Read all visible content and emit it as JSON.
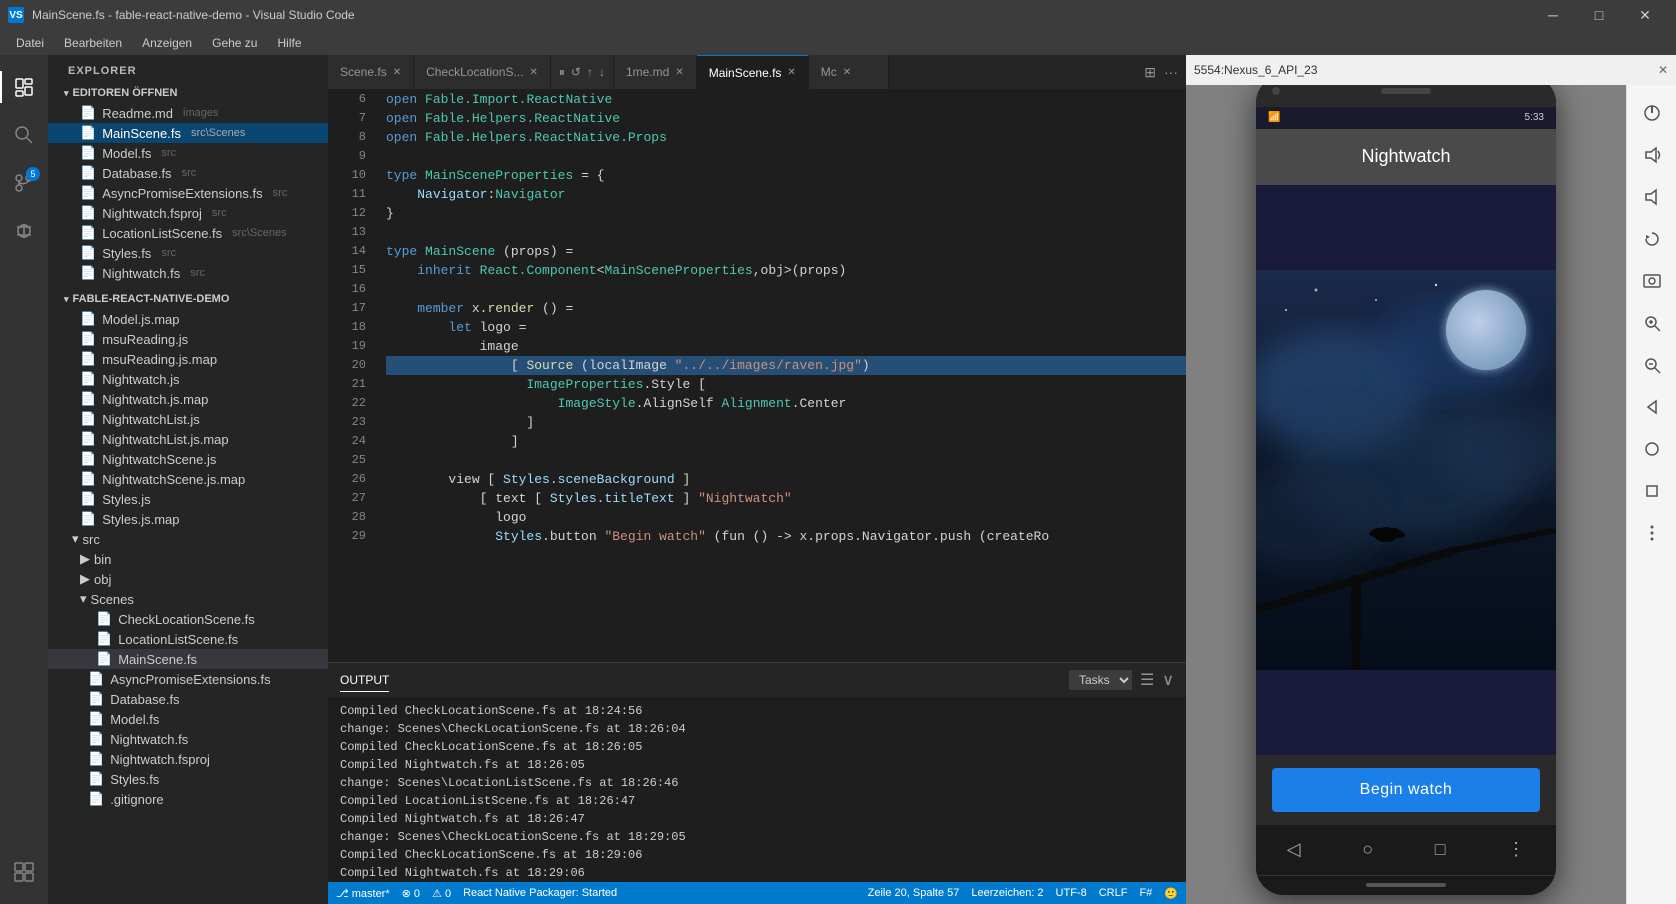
{
  "titleBar": {
    "icon": "VS",
    "title": "MainScene.fs - fable-react-native-demo - Visual Studio Code",
    "minimize": "─",
    "maximize": "□",
    "close": "✕"
  },
  "menuBar": {
    "items": [
      "Datei",
      "Bearbeiten",
      "Anzeigen",
      "Gehe zu",
      "Hilfe"
    ]
  },
  "activityBar": {
    "icons": [
      "files",
      "search",
      "git",
      "debug",
      "extensions"
    ]
  },
  "sidebar": {
    "title": "EXPLORER",
    "openEditors": {
      "label": "EDITOREN ÖFFNEN",
      "items": [
        {
          "name": "Readme.md",
          "hint": "images",
          "indent": 1
        },
        {
          "name": "MainScene.fs",
          "hint": "src\\Scenes",
          "indent": 1,
          "active": true
        },
        {
          "name": "Model.fs",
          "hint": "src",
          "indent": 1
        },
        {
          "name": "Database.fs",
          "hint": "src",
          "indent": 1
        },
        {
          "name": "AsyncPromiseExtensions.fs",
          "hint": "src",
          "indent": 1
        },
        {
          "name": "Nightwatch.fsproj",
          "hint": "src",
          "indent": 1
        },
        {
          "name": "LocationListScene.fs",
          "hint": "src\\Scenes",
          "indent": 1
        },
        {
          "name": "Styles.fs",
          "hint": "src",
          "indent": 1
        },
        {
          "name": "Nightwatch.fs",
          "hint": "src",
          "indent": 1
        }
      ]
    },
    "project": {
      "label": "FABLE-REACT-NATIVE-DEMO",
      "items": [
        {
          "name": "Model.js.map",
          "indent": 1
        },
        {
          "name": "msuReading.js",
          "indent": 1
        },
        {
          "name": "msuReading.js.map",
          "indent": 1
        },
        {
          "name": "Nightwatch.js",
          "indent": 1
        },
        {
          "name": "Nightwatch.js.map",
          "indent": 1
        },
        {
          "name": "NightwatchList.js",
          "indent": 1
        },
        {
          "name": "NightwatchList.js.map",
          "indent": 1
        },
        {
          "name": "NightwatchScene.js",
          "indent": 1
        },
        {
          "name": "NightwatchScene.js.map",
          "indent": 1
        },
        {
          "name": "Styles.js",
          "indent": 1
        },
        {
          "name": "Styles.js.map",
          "indent": 1
        },
        {
          "name": "src",
          "indent": 0,
          "isFolder": true
        },
        {
          "name": "bin",
          "indent": 1,
          "isFolder": true
        },
        {
          "name": "obj",
          "indent": 1,
          "isFolder": true
        },
        {
          "name": "Scenes",
          "indent": 1,
          "isFolder": true
        },
        {
          "name": "CheckLocationScene.fs",
          "indent": 2
        },
        {
          "name": "LocationListScene.fs",
          "indent": 2
        },
        {
          "name": "MainScene.fs",
          "indent": 2,
          "selected": true
        },
        {
          "name": "AsyncPromiseExtensions.fs",
          "indent": 1
        },
        {
          "name": "Database.fs",
          "indent": 1
        },
        {
          "name": "Model.fs",
          "indent": 1
        },
        {
          "name": "Nightwatch.fs",
          "indent": 1
        },
        {
          "name": "Nightwatch.fsproj",
          "indent": 1
        },
        {
          "name": "Styles.fs",
          "indent": 1
        },
        {
          "name": ".gitignore",
          "indent": 1
        }
      ]
    }
  },
  "tabs": [
    {
      "label": "Scene.fs",
      "active": false
    },
    {
      "label": "CheckLocationS...",
      "active": false
    },
    {
      "label": "1me.md",
      "active": false
    },
    {
      "label": "MainScene.fs",
      "active": true
    },
    {
      "label": "Mc",
      "active": false
    }
  ],
  "editor": {
    "lines": [
      {
        "num": 6,
        "content": "open Fable.Import.ReactNative",
        "highlight": false
      },
      {
        "num": 7,
        "content": "open Fable.Helpers.ReactNative",
        "highlight": false
      },
      {
        "num": 8,
        "content": "open Fable.Helpers.ReactNative.Props",
        "highlight": false
      },
      {
        "num": 9,
        "content": "",
        "highlight": false
      },
      {
        "num": 10,
        "content": "type MainSceneProperties = {",
        "highlight": false
      },
      {
        "num": 11,
        "content": "    Navigator:Navigator",
        "highlight": false
      },
      {
        "num": 12,
        "content": "}",
        "highlight": false
      },
      {
        "num": 13,
        "content": "",
        "highlight": false
      },
      {
        "num": 14,
        "content": "type MainScene (props) =",
        "highlight": false
      },
      {
        "num": 15,
        "content": "    inherit React.Component<MainSceneProperties,obj>(props)",
        "highlight": false
      },
      {
        "num": 16,
        "content": "",
        "highlight": false
      },
      {
        "num": 17,
        "content": "    member x.render () =",
        "highlight": false
      },
      {
        "num": 18,
        "content": "        let logo =",
        "highlight": false
      },
      {
        "num": 19,
        "content": "            image",
        "highlight": false
      },
      {
        "num": 20,
        "content": "                [ Source (localImage \"../../images/raven.jpg\")",
        "highlight": true
      },
      {
        "num": 21,
        "content": "                  ImageProperties.Style [",
        "highlight": false
      },
      {
        "num": 22,
        "content": "                      ImageStyle.AlignSelf Alignment.Center",
        "highlight": false
      },
      {
        "num": 23,
        "content": "                  ]",
        "highlight": false
      },
      {
        "num": 24,
        "content": "                ]",
        "highlight": false
      },
      {
        "num": 25,
        "content": "",
        "highlight": false
      },
      {
        "num": 26,
        "content": "        view [ Styles.sceneBackground ]",
        "highlight": false
      },
      {
        "num": 27,
        "content": "            [ text [ Styles.titleText ] \"Nightwatch\"",
        "highlight": false
      },
      {
        "num": 28,
        "content": "              logo",
        "highlight": false
      },
      {
        "num": 29,
        "content": "              Styles.button \"Begin watch\" (fun () -> x.props.Navigator.push (createRo",
        "highlight": false
      }
    ]
  },
  "output": {
    "tab": "OUTPUT",
    "selector": "Tasks",
    "lines": [
      "Compiled CheckLocationScene.fs at 18:24:56",
      "change: Scenes\\CheckLocationScene.fs at 18:26:04",
      "Compiled CheckLocationScene.fs at 18:26:05",
      "Compiled Nightwatch.fs at 18:26:05",
      "change: Scenes\\LocationListScene.fs at 18:26:46",
      "Compiled LocationListScene.fs at 18:26:47",
      "Compiled Nightwatch.fs at 18:26:47",
      "change: Scenes\\CheckLocationScene.fs at 18:29:05",
      "Compiled CheckLocationScene.fs at 18:29:06",
      "Compiled Nightwatch.fs at 18:29:06"
    ]
  },
  "statusBar": {
    "branch": "⎇ master*",
    "errors": "⊗ 0",
    "warnings": "⚠ 0",
    "packager": "React Native Packager: Started",
    "position": "Zeile 20, Spalte 57",
    "spaces": "Leerzeichen: 2",
    "encoding": "UTF-8",
    "lineEnding": "CRLF",
    "language": "F#"
  },
  "emulator": {
    "title": "5554:Nexus_6_API_23",
    "phone": {
      "time": "5:33",
      "appTitle": "Nightwatch",
      "beginWatchLabel": "Begin watch"
    }
  }
}
